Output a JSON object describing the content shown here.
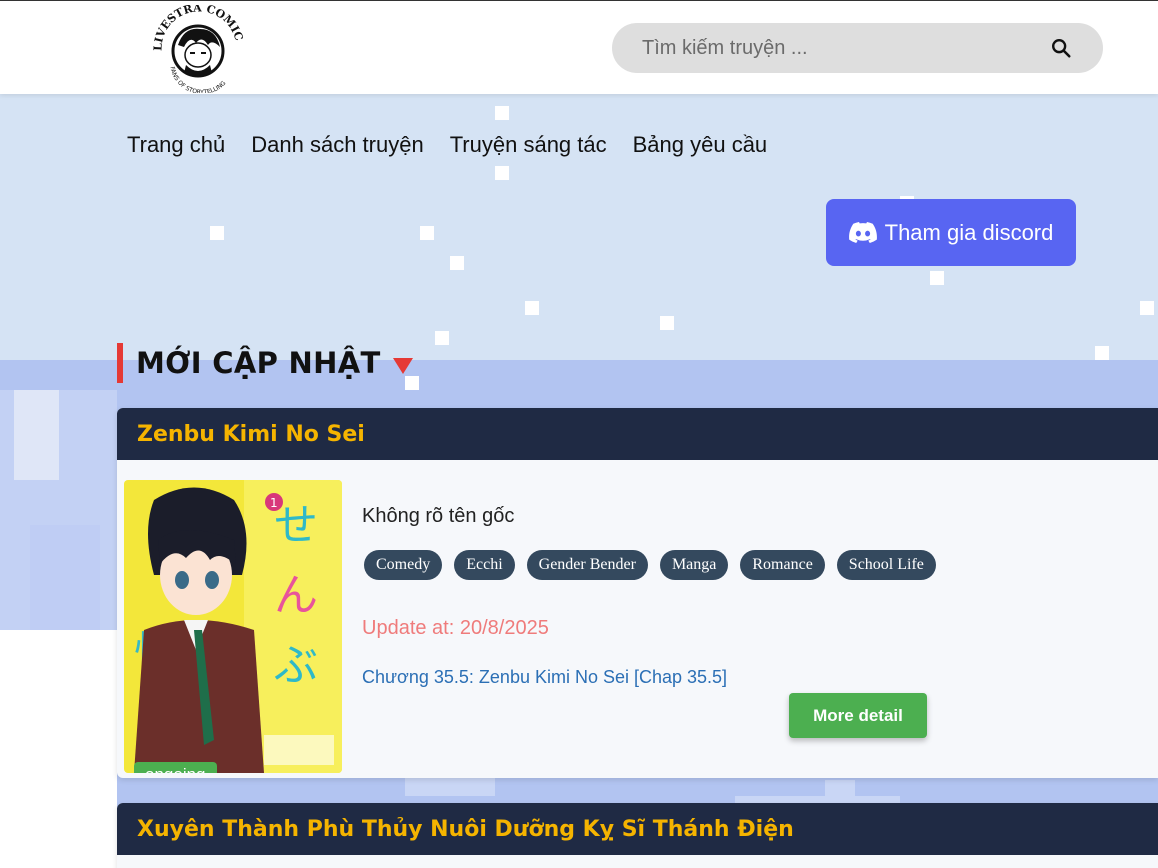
{
  "header": {
    "logo_alt": "Livestra Comics",
    "search_placeholder": "Tìm kiếm truyện ..."
  },
  "nav": {
    "items": [
      "Trang chủ",
      "Danh sách truyện",
      "Truyện sáng tác",
      "Bảng yêu cầu"
    ]
  },
  "discord": {
    "label": "Tham gia discord",
    "color": "#5865f2"
  },
  "section": {
    "title": "MỚI CẬP NHẬT"
  },
  "cards": [
    {
      "title": "Zenbu Kimi No Sei",
      "alt_name": "Không rõ tên gốc",
      "tags": [
        "Comedy",
        "Ecchi",
        "Gender Bender",
        "Manga",
        "Romance",
        "School Life"
      ],
      "update": "Update at: 20/8/2025",
      "chapter": "Chương 35.5: Zenbu Kimi No Sei [Chap 35.5]",
      "status": "ongoing",
      "more_label": "More detail"
    },
    {
      "title": "Xuyên Thành Phù Thủy Nuôi Dưỡng Kỵ Sĩ Thánh Điện"
    }
  ],
  "colors": {
    "header_bg": "#ffffff",
    "card_head_bg": "#1f2a44",
    "card_title": "#f5b400",
    "accent_red": "#e53935",
    "status_green": "#4caf50",
    "tag_bg": "#34495e"
  }
}
